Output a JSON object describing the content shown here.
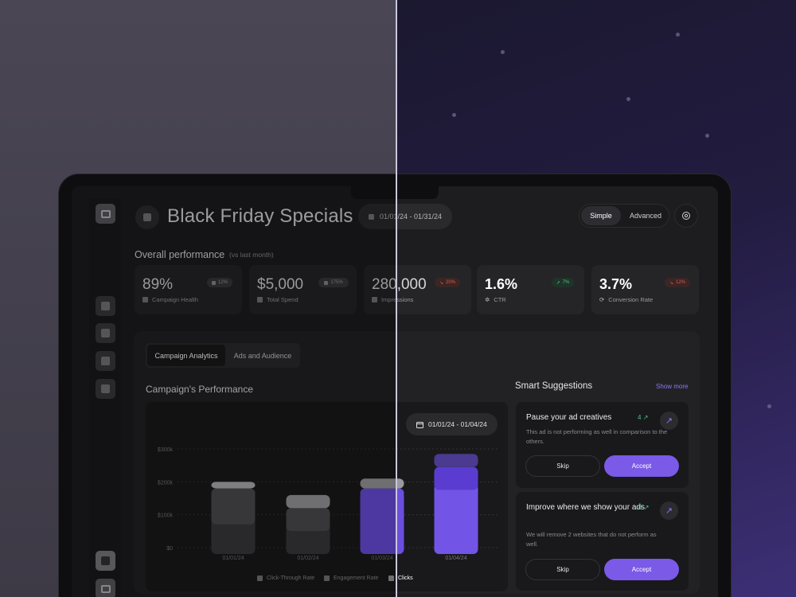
{
  "app": {
    "page_title": "Black Friday Specials",
    "date_range": "01/01/24 - 01/31/24"
  },
  "mode_toggle": {
    "simple": "Simple",
    "advanced": "Advanced",
    "selected": "Simple"
  },
  "overview": {
    "title": "Overall performance",
    "subtitle": "(vs last month)"
  },
  "kpis": [
    {
      "value": "89%",
      "label": "Campaign Health",
      "badge": "12%",
      "trend": "neutral"
    },
    {
      "value": "$5,000",
      "label": "Total Spend",
      "badge": "175%",
      "trend": "neutral"
    },
    {
      "value": "280,000",
      "label": "Impressions",
      "badge": "20%",
      "trend": "down"
    },
    {
      "value": "1.6%",
      "label": "CTR",
      "badge": "7%",
      "trend": "up"
    },
    {
      "value": "3.7%",
      "label": "Conversion Rate",
      "badge": "12%",
      "trend": "down"
    }
  ],
  "tabs": [
    {
      "label": "Campaign Analytics",
      "active": true
    },
    {
      "label": "Ads and Audience",
      "active": false
    }
  ],
  "performance": {
    "title": "Campaign's Performance",
    "date_filter": "01/01/24 - 01/04/24"
  },
  "chart_data": {
    "type": "bar",
    "stacked": true,
    "categories": [
      "01/01/24",
      "01/02/24",
      "01/03/24",
      "01/04/24"
    ],
    "y_ticks": [
      "$0",
      "$100k",
      "$200k",
      "$300k"
    ],
    "ylim": [
      0,
      300000
    ],
    "grid": true,
    "legend_placement": "bottom",
    "series": [
      {
        "name": "Click-Through Rate",
        "values": [
          90000,
          70000,
          170000,
          195000
        ]
      },
      {
        "name": "Engagement Rate",
        "values": [
          90000,
          50000,
          10000,
          50000
        ]
      },
      {
        "name": "Clicks",
        "values": [
          20000,
          40000,
          30000,
          40000
        ]
      }
    ]
  },
  "legend": [
    {
      "label": "Click-Through Rate",
      "color": "#777779"
    },
    {
      "label": "Engagement Rate",
      "color": "#77777b"
    },
    {
      "label": "Clicks",
      "color": "#9a9a9e"
    }
  ],
  "suggestions": {
    "title": "Smart Suggestions",
    "show_more": "Show more",
    "items": [
      {
        "title": "Pause your ad creatives",
        "count": "4",
        "description": "This ad is not performing as well in comparison to the others.",
        "skip": "Skip",
        "accept": "Accept"
      },
      {
        "title": "Improve where we show your ads",
        "count": "6",
        "description": "We will remove 2 websites that do not perform as well.",
        "skip": "Skip",
        "accept": "Accept"
      }
    ]
  },
  "colors": {
    "accent": "#7a5ae6",
    "positive": "#4cc48a",
    "negative": "#e0584e"
  }
}
